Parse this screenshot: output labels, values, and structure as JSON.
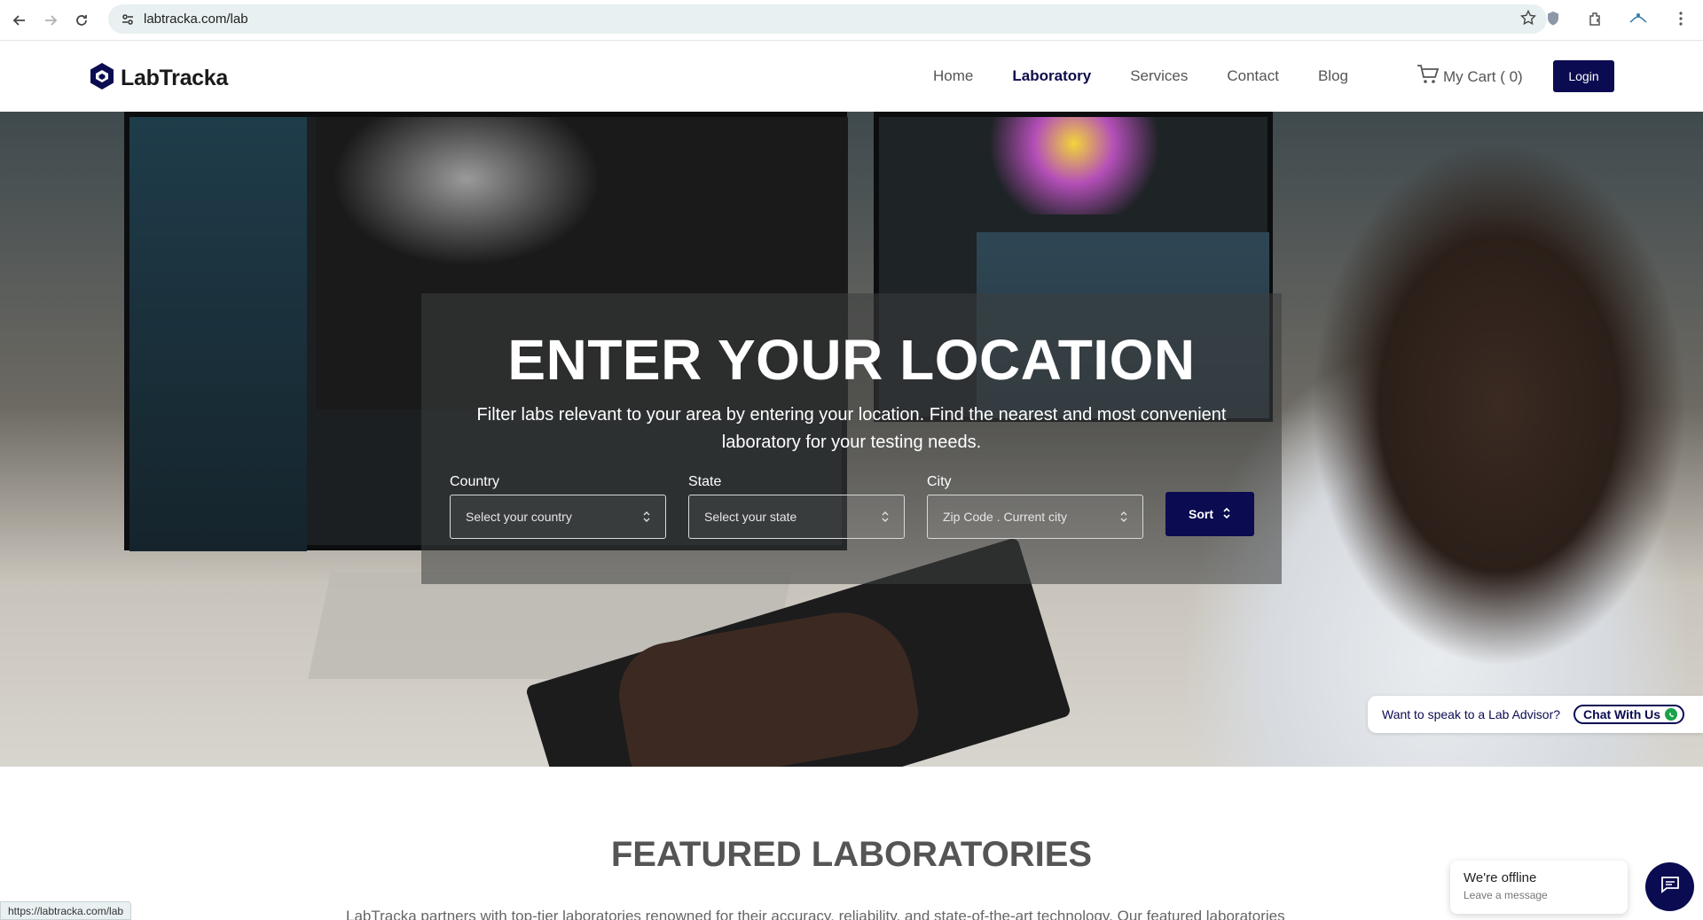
{
  "browser": {
    "url": "labtracka.com/lab",
    "status_url": "https://labtracka.com/lab"
  },
  "header": {
    "logo_text": "LabTracka",
    "nav": [
      {
        "label": "Home",
        "active": false
      },
      {
        "label": "Laboratory",
        "active": true
      },
      {
        "label": "Services",
        "active": false
      },
      {
        "label": "Contact",
        "active": false
      },
      {
        "label": "Blog",
        "active": false
      }
    ],
    "cart_label": "My Cart ( 0)",
    "login_label": "Login"
  },
  "hero": {
    "title": "ENTER YOUR LOCATION",
    "subtitle": "Filter labs relevant to your area by entering your location. Find the nearest and most convenient laboratory for your testing needs.",
    "country": {
      "label": "Country",
      "placeholder": "Select your country"
    },
    "state": {
      "label": "State",
      "placeholder": "Select your state"
    },
    "city": {
      "label": "City",
      "placeholder": "Zip Code . Current city"
    },
    "sort_label": "Sort"
  },
  "advisor": {
    "text": "Want to speak to a Lab Advisor?",
    "chat_label": "Chat With Us"
  },
  "featured": {
    "title": "FEATURED LABORATORIES",
    "text": "LabTracka partners with top-tier laboratories renowned for their accuracy, reliability, and state-of-the-art technology. Our featured laboratories"
  },
  "chat_widget": {
    "title": "We're offline",
    "subtitle": "Leave a message"
  },
  "colors": {
    "brand_navy": "#0b0b52",
    "url_bar": "#e8f0f1",
    "whatsapp_green": "#1aa34a"
  },
  "icons": [
    "back-icon",
    "forward-icon",
    "reload-icon",
    "site-info-icon",
    "star-icon",
    "shield-icon",
    "extensions-icon",
    "profile-icon",
    "menu-icon",
    "logo-icon",
    "cart-icon",
    "chevron-updown-icon",
    "whatsapp-icon",
    "chat-icon"
  ]
}
